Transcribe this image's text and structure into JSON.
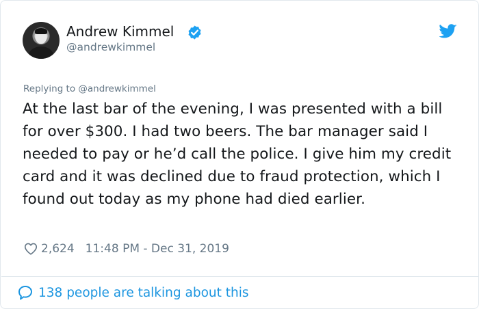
{
  "author": {
    "name": "Andrew Kimmel",
    "handle": "@andrewkimmel"
  },
  "reply_context": "Replying to @andrewkimmel",
  "tweet_text": "At the last bar of the evening, I was presented with a bill for over $300. I had two beers. The bar manager said I needed to pay or he’d call the police. I give him my credit card and it was declined due to fraud protection, which I found out today as my phone had died earlier.",
  "likes_count": "2,624",
  "timestamp": "11:48 PM - Dec 31, 2019",
  "talking_text": "138 people are talking about this",
  "icons": {
    "verified": "verified-badge-icon",
    "brand": "twitter-bird-icon",
    "like": "heart-icon",
    "conversation": "speech-bubble-icon"
  },
  "colors": {
    "twitter_blue": "#1da1f2",
    "link_blue": "#1b95e0",
    "secondary_text": "#657786",
    "primary_text": "#14171a"
  }
}
